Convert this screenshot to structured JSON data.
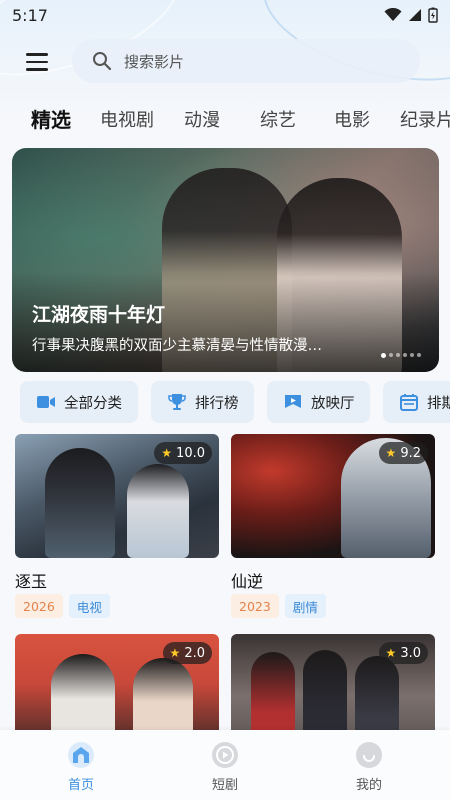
{
  "status_bar": {
    "time": "5:17"
  },
  "search": {
    "placeholder": "搜索影片"
  },
  "tabs": [
    {
      "label": "精选",
      "active": true
    },
    {
      "label": "电视剧",
      "active": false
    },
    {
      "label": "动漫",
      "active": false
    },
    {
      "label": "综艺",
      "active": false
    },
    {
      "label": "电影",
      "active": false
    },
    {
      "label": "纪录片",
      "active": false
    }
  ],
  "banner": {
    "title": "江湖夜雨十年灯",
    "description": "行事果决腹黑的双面少主慕清晏与性情散漫…",
    "slide_count": 6,
    "active_slide": 1
  },
  "quick_links": [
    {
      "label": "全部分类",
      "icon": "video-camera-icon"
    },
    {
      "label": "排行榜",
      "icon": "trophy-icon"
    },
    {
      "label": "放映厅",
      "icon": "screening-hall-icon"
    },
    {
      "label": "排期",
      "icon": "calendar-icon"
    }
  ],
  "cards": [
    {
      "title": "逐玉",
      "rating": "10.0",
      "year": "2026",
      "genre": "电视"
    },
    {
      "title": "仙逆",
      "rating": "9.2",
      "year": "2023",
      "genre": "剧情"
    },
    {
      "title": "",
      "rating": "2.0",
      "year": "",
      "genre": ""
    },
    {
      "title": "",
      "rating": "3.0",
      "year": "",
      "genre": ""
    }
  ],
  "bottom_nav": [
    {
      "label": "首页",
      "icon": "home-icon",
      "active": true
    },
    {
      "label": "短剧",
      "icon": "play-circle-icon",
      "active": false
    },
    {
      "label": "我的",
      "icon": "profile-icon",
      "active": false
    }
  ],
  "colors": {
    "accent": "#3d8fe0",
    "year_tag_text": "#e2844c",
    "genre_tag_text": "#3e8ad6",
    "rating_star": "#ffc928"
  }
}
